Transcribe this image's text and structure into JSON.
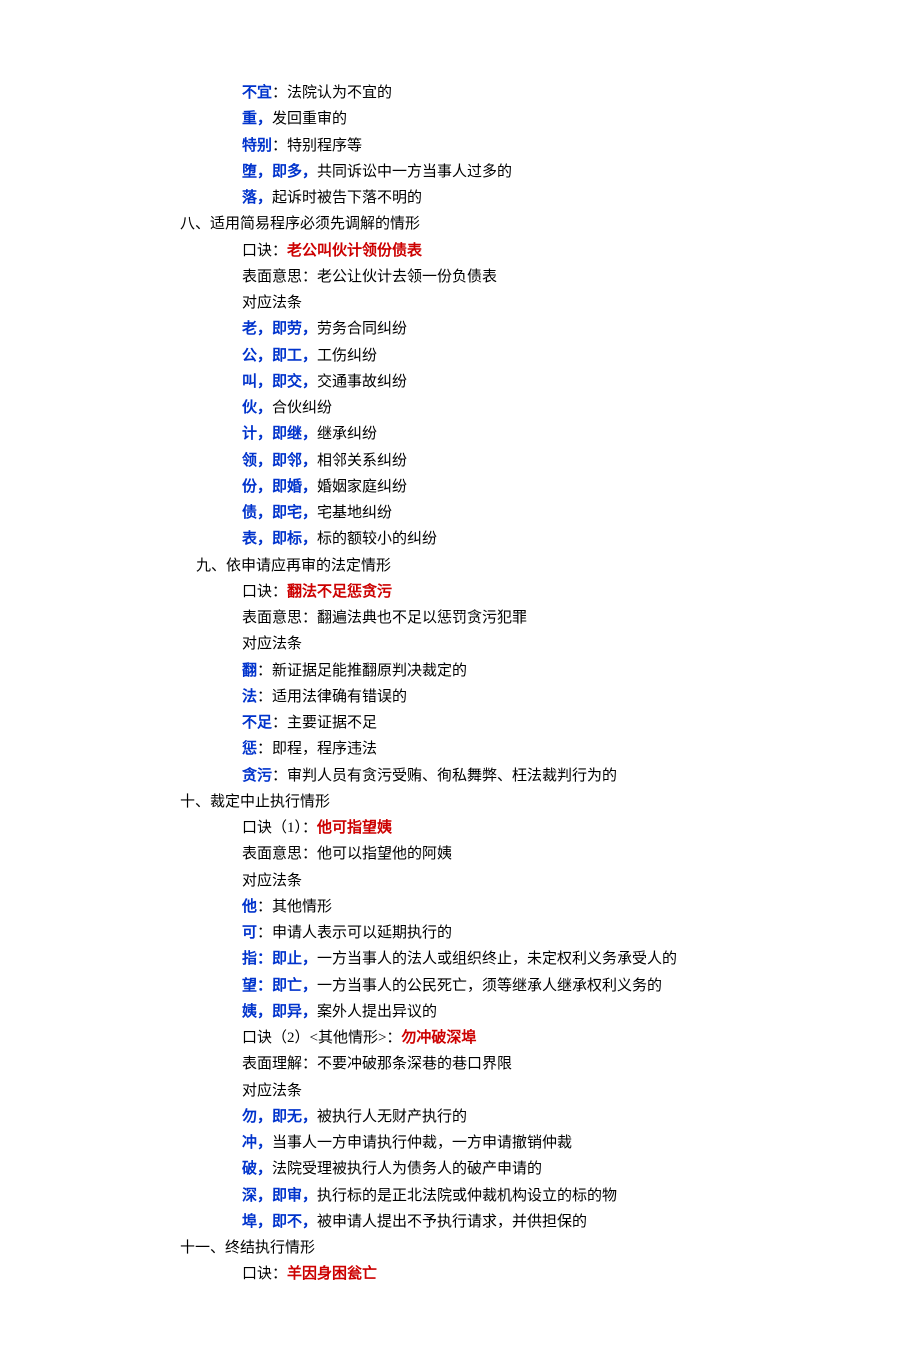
{
  "pre": [
    {
      "blue": "不宜",
      "rest": "：法院认为不宜的"
    },
    {
      "blue": "重，",
      "rest": "发回重审的"
    },
    {
      "blue": "特别",
      "rest": "：特别程序等"
    },
    {
      "blue": "堕，即多，",
      "rest": "共同诉讼中一方当事人过多的"
    },
    {
      "blue": "落，",
      "rest": "起诉时被告下落不明的"
    }
  ],
  "s8": {
    "title": "八、适用简易程序必须先调解的情形",
    "koujue_label": "口诀：",
    "koujue_text": "老公叫伙计领份债表",
    "meaning": "表面意思：老公让伙计去领一份负债表",
    "ref": "对应法条",
    "items": [
      {
        "blue": "老，即劳，",
        "rest": "劳务合同纠纷"
      },
      {
        "blue": "公，即工，",
        "rest": "工伤纠纷"
      },
      {
        "blue": "叫，即交，",
        "rest": "交通事故纠纷"
      },
      {
        "blue": "伙，",
        "rest": "合伙纠纷"
      },
      {
        "blue": "计，即继，",
        "rest": "继承纠纷"
      },
      {
        "blue": "领，即邻，",
        "rest": "相邻关系纠纷"
      },
      {
        "blue": "份，即婚，",
        "rest": "婚姻家庭纠纷"
      },
      {
        "blue": "债，即宅，",
        "rest": "宅基地纠纷"
      },
      {
        "blue": "表，即标，",
        "rest": "标的额较小的纠纷"
      }
    ]
  },
  "s9": {
    "title": "九、依申请应再审的法定情形",
    "koujue_label": "口诀：",
    "koujue_text": "翻法不足惩贪污",
    "meaning": "表面意思：翻遍法典也不足以惩罚贪污犯罪",
    "ref": "对应法条",
    "items": [
      {
        "blue": "翻",
        "rest": "：新证据足能推翻原判决裁定的"
      },
      {
        "blue": "法",
        "rest": "：适用法律确有错误的"
      },
      {
        "blue": "不足",
        "rest": "：主要证据不足"
      },
      {
        "blue": "惩",
        "rest": "：即程，程序违法"
      },
      {
        "blue": "贪污",
        "rest": "：审判人员有贪污受贿、徇私舞弊、枉法裁判行为的"
      }
    ]
  },
  "s10": {
    "title": "十、裁定中止执行情形",
    "k1_label": "口诀（1）：",
    "k1_text": "他可指望姨",
    "meaning1": "表面意思：他可以指望他的阿姨",
    "ref1": "对应法条",
    "items1": [
      {
        "blue": "他",
        "rest": "：其他情形"
      },
      {
        "blue": "可",
        "rest": "：申请人表示可以延期执行的"
      },
      {
        "blue": "指：即止，",
        "rest": "一方当事人的法人或组织终止，未定权利义务承受人的"
      },
      {
        "blue": "望：即亡，",
        "rest": "一方当事人的公民死亡，须等继承人继承权利义务的"
      },
      {
        "blue": "姨，即异，",
        "rest": "案外人提出异议的"
      }
    ],
    "k2_label": "口诀（2）<其他情形>：",
    "k2_text": "勿冲破深埠",
    "meaning2": "表面理解：不要冲破那条深巷的巷口界限",
    "ref2": "对应法条",
    "items2": [
      {
        "blue": "勿，即无，",
        "rest": "被执行人无财产执行的"
      },
      {
        "blue": "冲，",
        "rest": "当事人一方申请执行仲裁，一方申请撤销仲裁"
      },
      {
        "blue": "破，",
        "rest": "法院受理被执行人为债务人的破产申请的"
      },
      {
        "blue": "深，即审，",
        "rest": "执行标的是正北法院或仲裁机构设立的标的物"
      },
      {
        "blue": "埠，即不，",
        "rest": "被申请人提出不予执行请求，并供担保的"
      }
    ]
  },
  "s11": {
    "title": "十一、终结执行情形",
    "koujue_label": "口诀：",
    "koujue_text": "羊因身困瓮亡"
  }
}
